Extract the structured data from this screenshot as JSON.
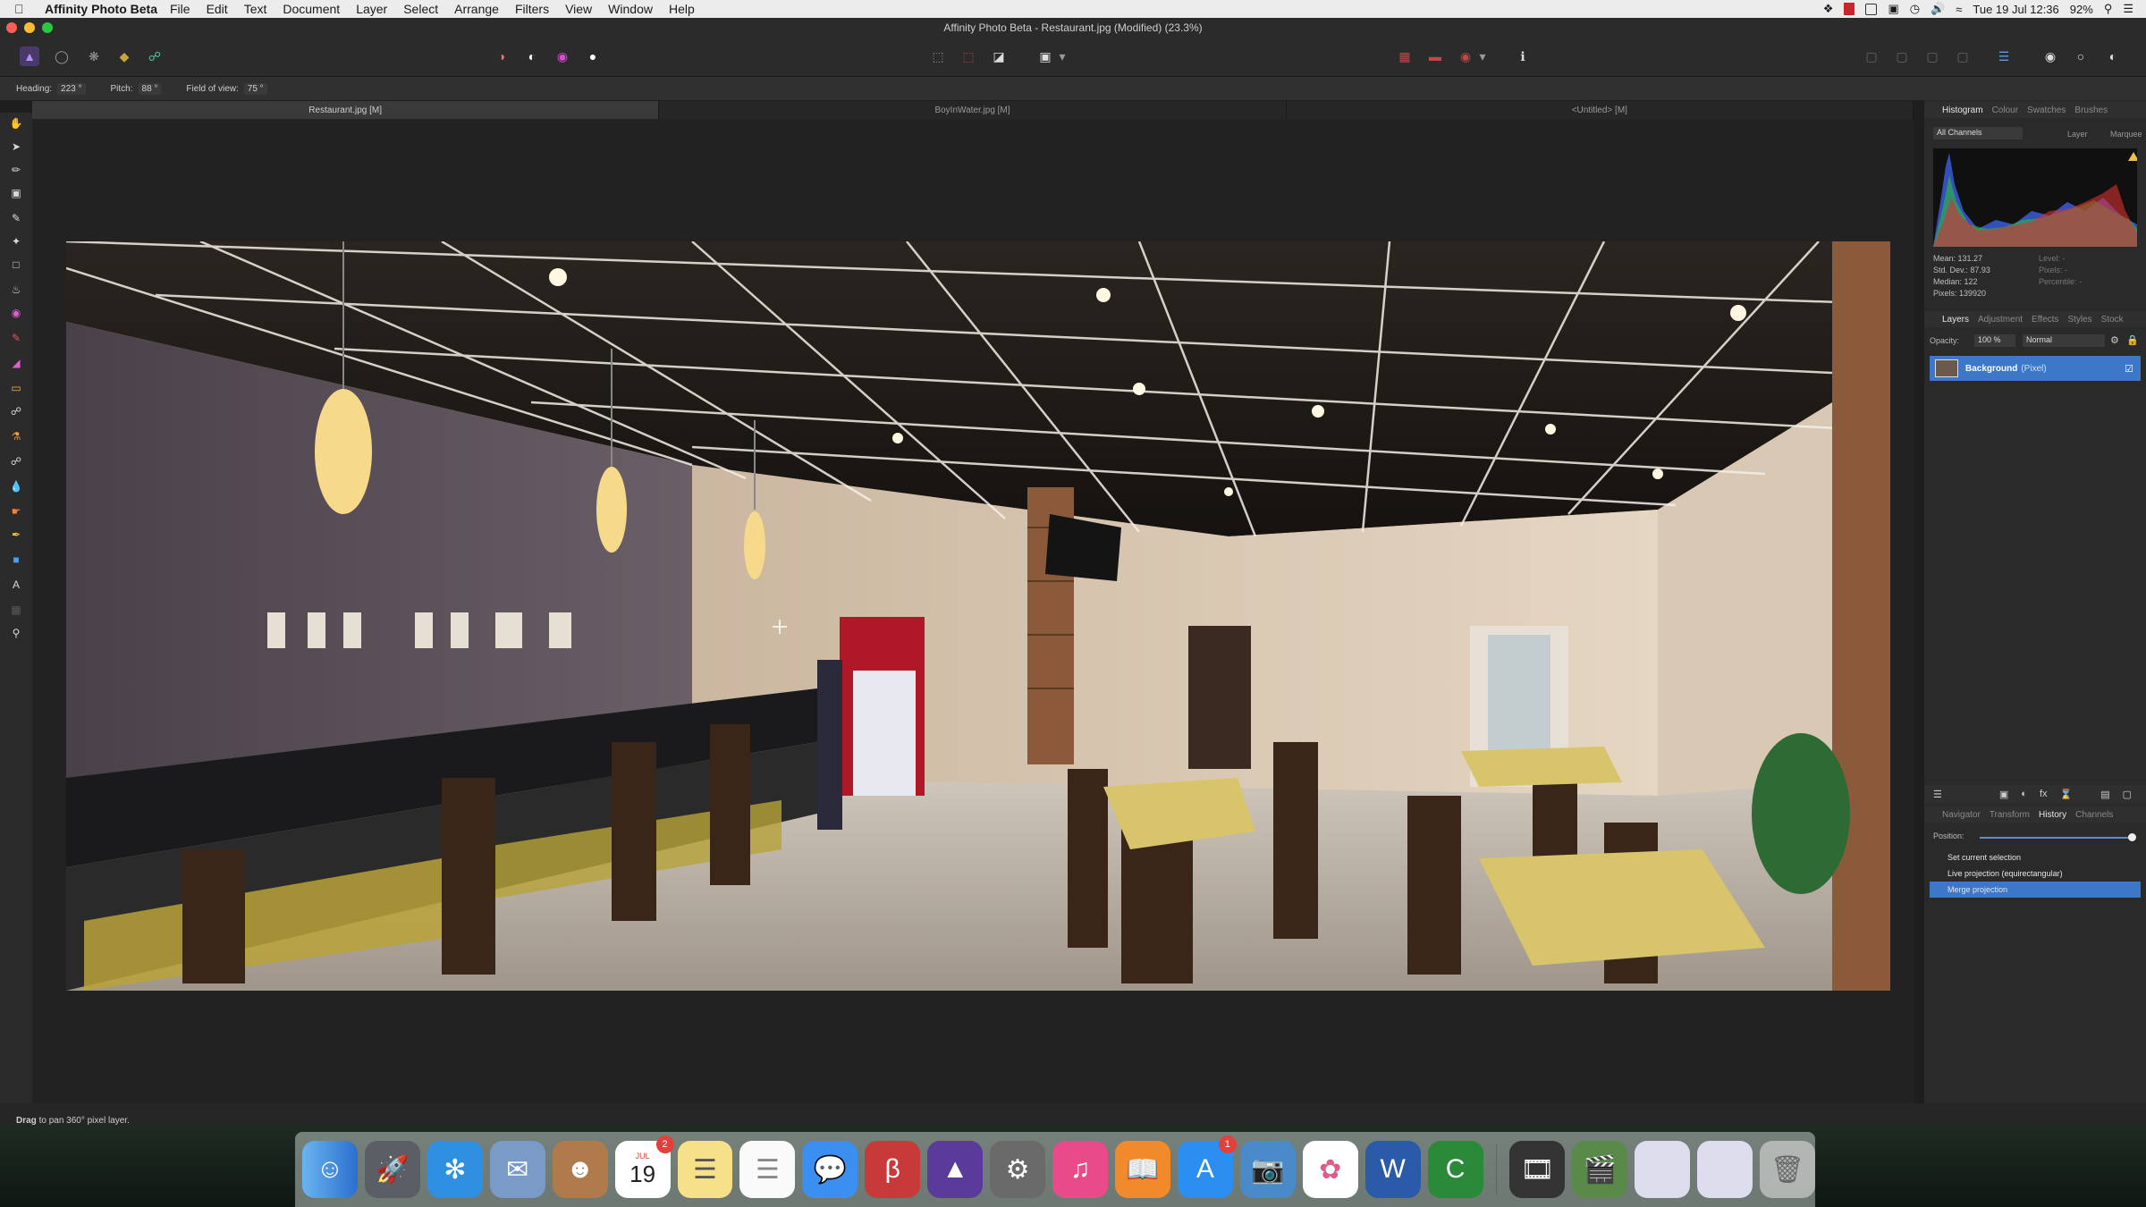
{
  "menubar": {
    "app_name": "Affinity Photo Beta",
    "menus": [
      "File",
      "Edit",
      "Text",
      "Document",
      "Layer",
      "Select",
      "Arrange",
      "Filters",
      "View",
      "Window",
      "Help"
    ],
    "datetime": "Tue 19 Jul 12:36",
    "battery": "92%"
  },
  "window": {
    "title": "Affinity Photo Beta - Restaurant.jpg (Modified) (23.3%)"
  },
  "context": {
    "heading_label": "Heading:",
    "heading_value": "223 °",
    "pitch_label": "Pitch:",
    "pitch_value": "88 °",
    "fov_label": "Field of view:",
    "fov_value": "75 °"
  },
  "doc_tabs": [
    "Restaurant.jpg [M]",
    "BoyInWater.jpg [M]",
    "<Untitled> [M]"
  ],
  "histogram": {
    "tabs": [
      "Histogram",
      "Colour",
      "Swatches",
      "Brushes"
    ],
    "channel": "All Channels",
    "layer_label": "Layer",
    "marquee_label": "Marquee",
    "stats": [
      "Mean: 131.27",
      "Std. Dev.: 87.93",
      "Median: 122",
      "Pixels: 139920"
    ],
    "stats2": [
      "Level: -",
      "Pixels: -",
      "Percentile: -"
    ]
  },
  "layers": {
    "tabs": [
      "Layers",
      "Adjustment",
      "Effects",
      "Styles",
      "Stock"
    ],
    "opacity_label": "Opacity:",
    "opacity_value": "100 %",
    "blend_mode": "Normal",
    "layer_name": "Background",
    "layer_type": "(Pixel)"
  },
  "history": {
    "tabs": [
      "Navigator",
      "Transform",
      "History",
      "Channels"
    ],
    "position_label": "Position:",
    "items": [
      "Set current selection",
      "Live projection (equirectangular)",
      "Merge projection"
    ]
  },
  "status": {
    "hint_bold": "Drag",
    "hint": "to pan 360° pixel layer."
  },
  "dock": {
    "calendar_month": "JUL",
    "calendar_day": "19",
    "calendar_badge": "2",
    "appstore_badge": "1",
    "icons": [
      "finder-icon",
      "launchpad-icon",
      "safari-icon",
      "mail-icon",
      "contacts-icon",
      "calendar-icon",
      "notes-icon",
      "reminders-icon",
      "messages-icon",
      "affinity-designer-icon",
      "affinity-photo-icon",
      "system-preferences-icon",
      "itunes-icon",
      "ibooks-icon",
      "app-store-icon",
      "preview-icon",
      "photos-icon",
      "word-icon",
      "camtasia-icon",
      "screenshot-icon",
      "screenflow-icon",
      "window-icon",
      "spreadsheet-icon",
      "trash-icon"
    ]
  },
  "colors": {
    "accent": "#3d78c8",
    "panel": "#2a2a2a",
    "canvas": "#222222"
  }
}
